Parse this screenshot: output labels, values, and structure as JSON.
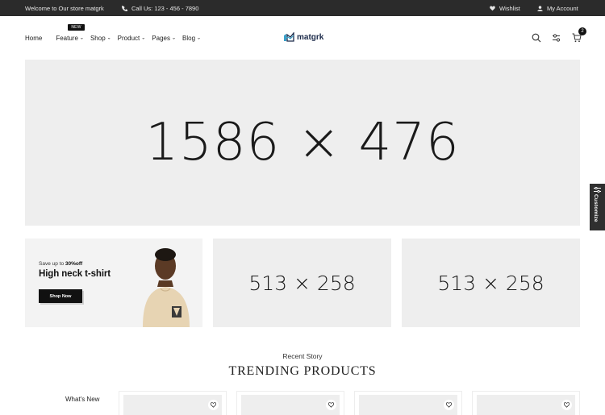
{
  "topbar": {
    "welcome": "Welcome to Our store matgrk",
    "phone": "Call Us: 123 - 456 - 7890",
    "wishlist": "Wishlist",
    "account": "My Account"
  },
  "nav": {
    "items": [
      {
        "label": "Home",
        "dropdown": false
      },
      {
        "label": "Feature",
        "dropdown": true,
        "badge": "NEW"
      },
      {
        "label": "Shop",
        "dropdown": true
      },
      {
        "label": "Product",
        "dropdown": true
      },
      {
        "label": "Pages",
        "dropdown": true
      },
      {
        "label": "Blog",
        "dropdown": true
      }
    ]
  },
  "logo": {
    "text": "matgrk"
  },
  "header_icons": {
    "search": "search-icon",
    "compare": "compare-icon",
    "cart": "cart-icon",
    "cart_count": "2"
  },
  "hero": {
    "placeholder": "1586 × 476"
  },
  "promo": {
    "save_prefix": "Save up to ",
    "save_value": "30%off",
    "headline": "High neck t-shirt",
    "button": "Shop Now"
  },
  "small_banners": [
    "513 × 258",
    "513 × 258"
  ],
  "customize": {
    "label": "Customize"
  },
  "section": {
    "subtitle": "Recent Story",
    "title": "TRENDING PRODUCTS",
    "tab": "What's New"
  },
  "colors": {
    "topbar_bg": "#2b2b2b",
    "placeholder_bg": "#eeeeee",
    "accent": "#111111",
    "logo": "#1c2b4a"
  }
}
